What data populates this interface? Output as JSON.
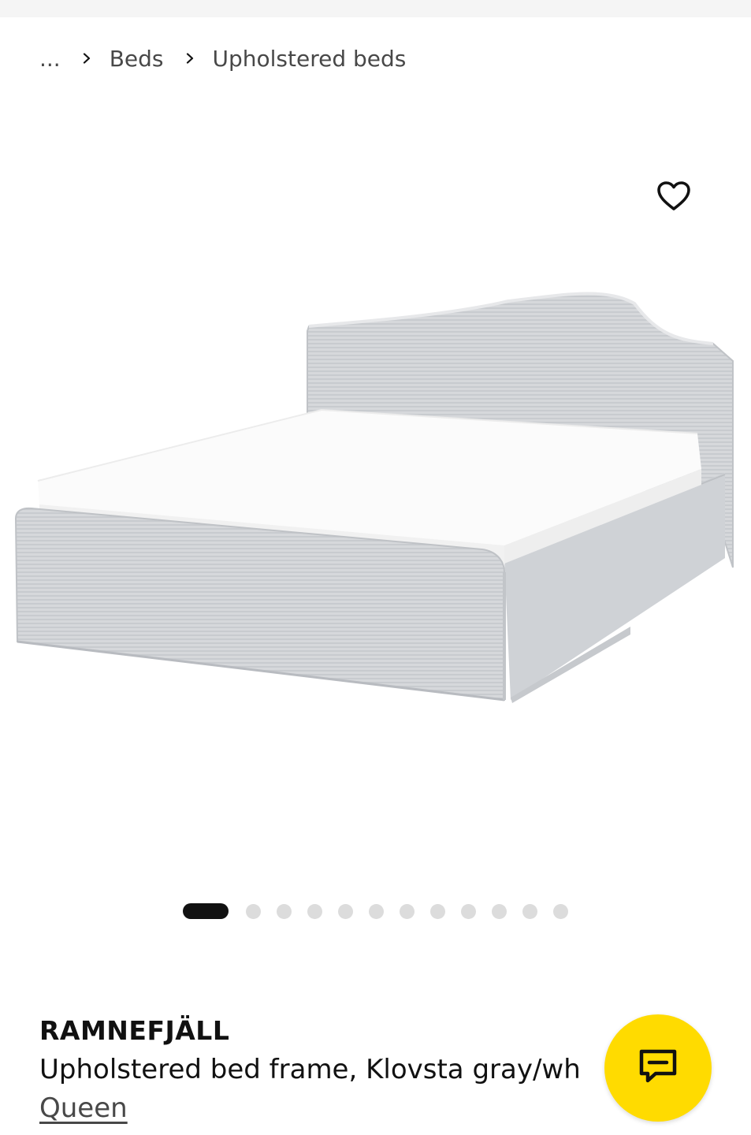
{
  "breadcrumb": {
    "ellipsis": "...",
    "items": [
      {
        "label": "Beds"
      },
      {
        "label": "Upholstered beds"
      }
    ]
  },
  "icons": {
    "favorite": "heart-icon",
    "chat": "chat-bubble-icon",
    "separator": "chevron-right-icon"
  },
  "gallery": {
    "image_count": 12,
    "active_index": 0
  },
  "product": {
    "name": "RAMNEFJÄLL",
    "description": "Upholstered bed frame, Klovsta gray/wh",
    "size": "Queen"
  },
  "colors": {
    "chat_button": "#ffdb00",
    "active_dot": "#111111",
    "inactive_dot": "#dcdcdc"
  }
}
